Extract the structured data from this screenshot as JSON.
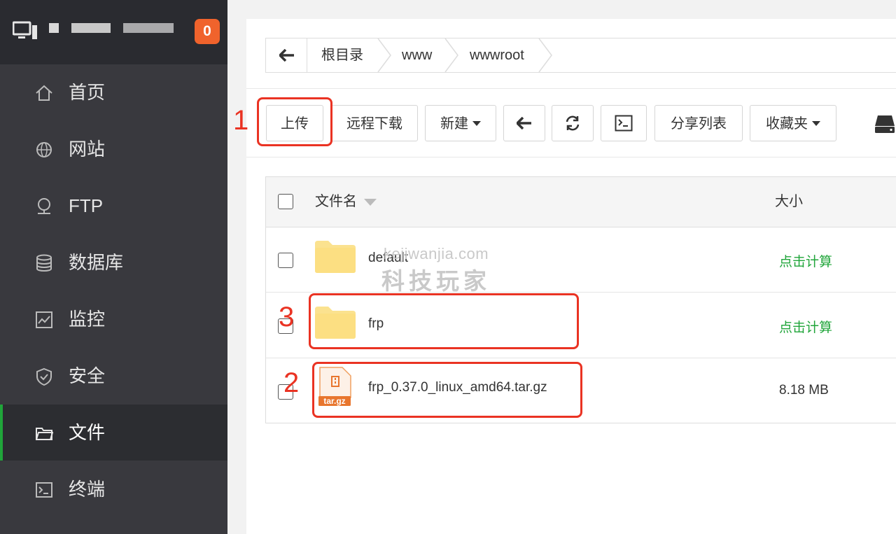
{
  "sidebar": {
    "badge": "0",
    "items": [
      {
        "label": "首页",
        "icon": "home-icon"
      },
      {
        "label": "网站",
        "icon": "globe-icon"
      },
      {
        "label": "FTP",
        "icon": "ftp-icon"
      },
      {
        "label": "数据库",
        "icon": "database-icon"
      },
      {
        "label": "监控",
        "icon": "monitor-icon"
      },
      {
        "label": "安全",
        "icon": "shield-icon"
      },
      {
        "label": "文件",
        "icon": "folder-icon",
        "active": true
      },
      {
        "label": "终端",
        "icon": "terminal-icon"
      }
    ]
  },
  "breadcrumb": [
    "根目录",
    "www",
    "wwwroot"
  ],
  "toolbar": {
    "upload": "上传",
    "remote_download": "远程下载",
    "new": "新建",
    "share_list": "分享列表",
    "favorites": "收藏夹"
  },
  "table": {
    "col_name": "文件名",
    "col_size": "大小",
    "rows": [
      {
        "name": "default",
        "type": "folder",
        "size": "点击计算"
      },
      {
        "name": "frp",
        "type": "folder",
        "size": "点击计算"
      },
      {
        "name": "frp_0.37.0_linux_amd64.tar.gz",
        "type": "archive",
        "size": "8.18 MB",
        "ext_label": "tar.gz"
      }
    ]
  },
  "annotations": [
    "1",
    "2",
    "3"
  ],
  "watermark": {
    "line1": "kejiwanjia.com",
    "line2": "科技玩家"
  },
  "colors": {
    "accent": "#20a53a",
    "badge": "#f0632c",
    "highlight": "#ea3323",
    "sidebar": "#39393e"
  }
}
